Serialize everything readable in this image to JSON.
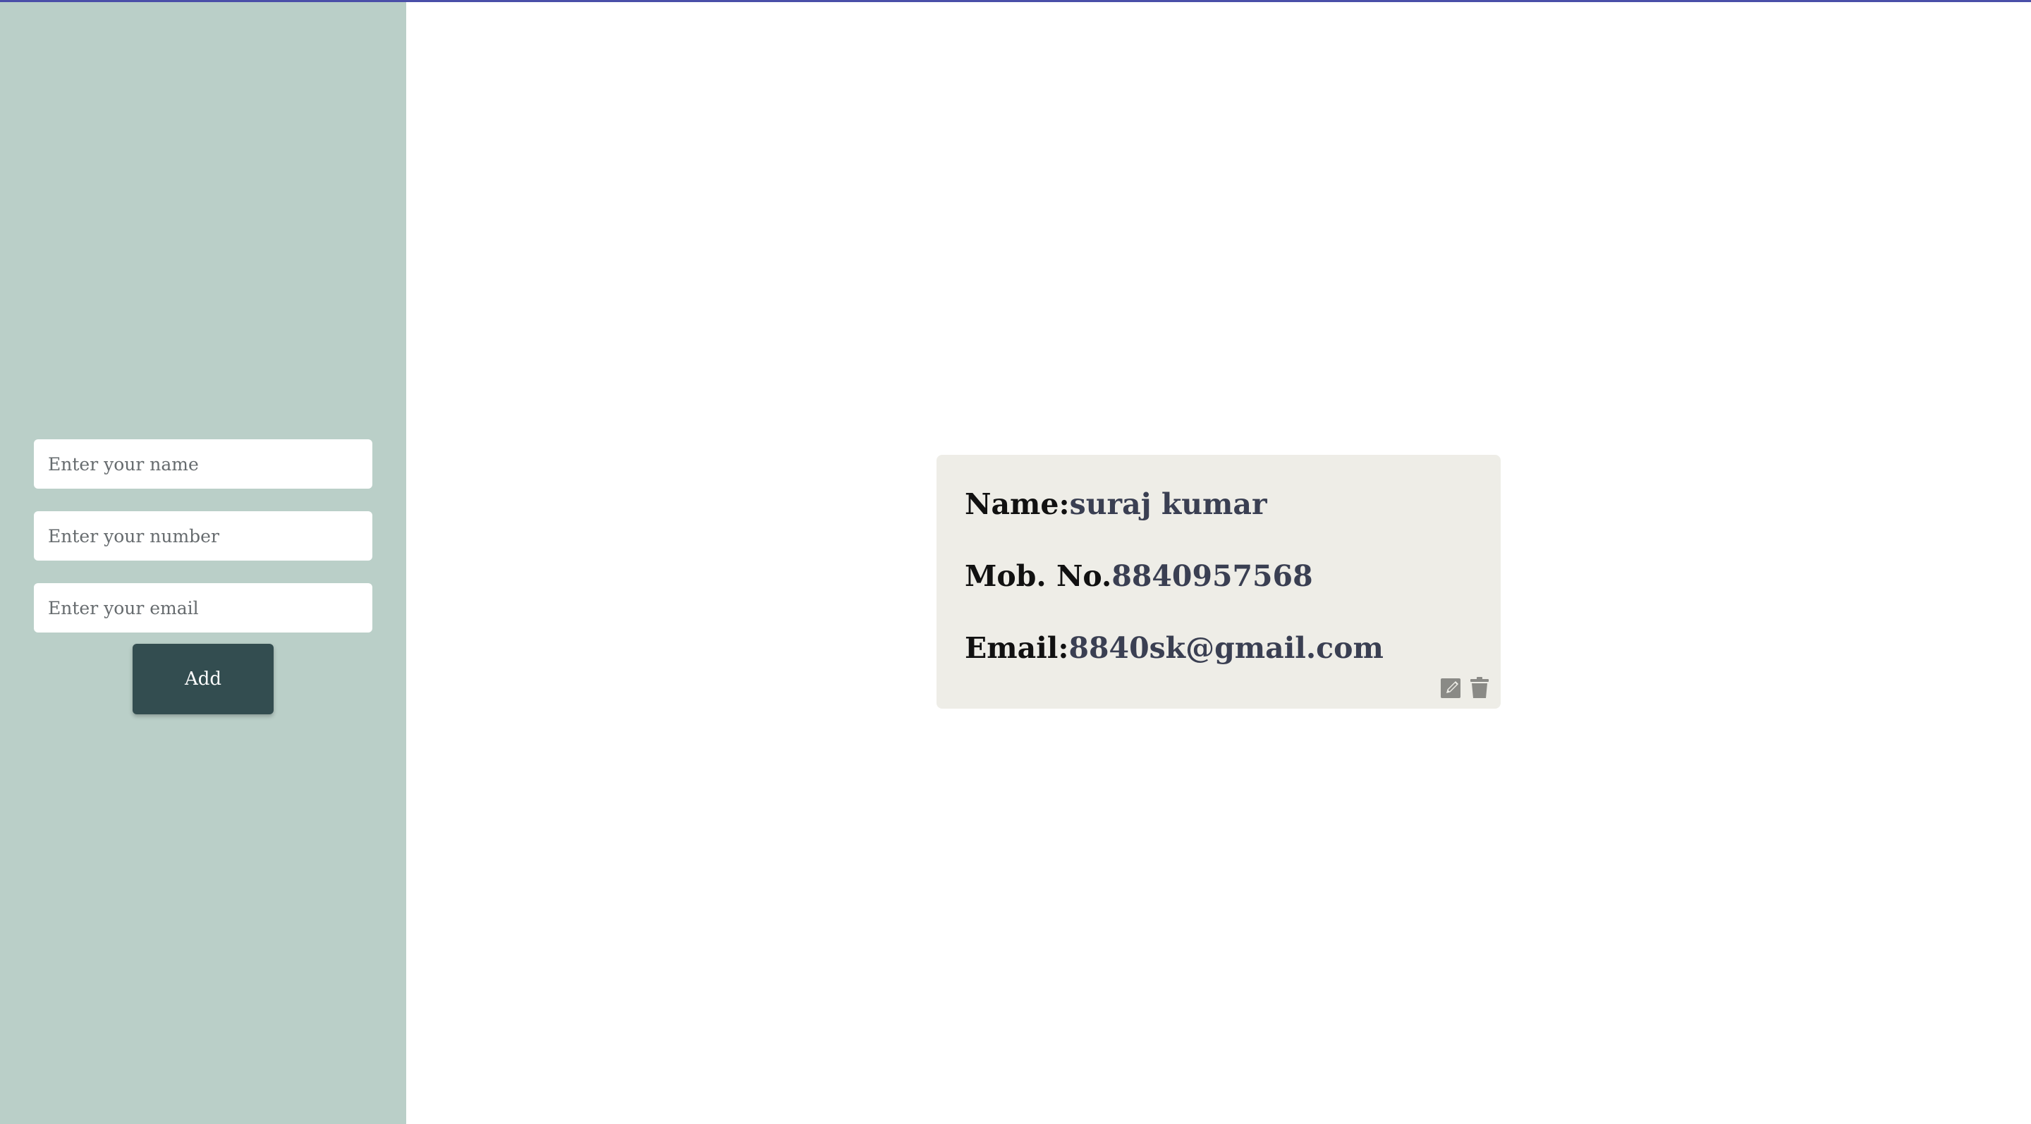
{
  "form": {
    "name_placeholder": "Enter your name",
    "number_placeholder": "Enter your number",
    "email_placeholder": "Enter your email",
    "add_label": "Add"
  },
  "contact": {
    "name_label": "Name:",
    "name_value": "suraj kumar",
    "mobile_label": "Mob. No.",
    "mobile_value": "8840957568",
    "email_label": "Email:",
    "email_value": "8840sk@gmail.com",
    "icons": [
      "edit-icon",
      "delete-icon"
    ]
  },
  "colors": {
    "sidebar_bg": "#bacfc8",
    "button_bg": "#334d50",
    "card_bg": "#eeede7",
    "value_text": "#3a3f52",
    "icon": "#8a8a86",
    "top_line": "#4a4fa8"
  }
}
